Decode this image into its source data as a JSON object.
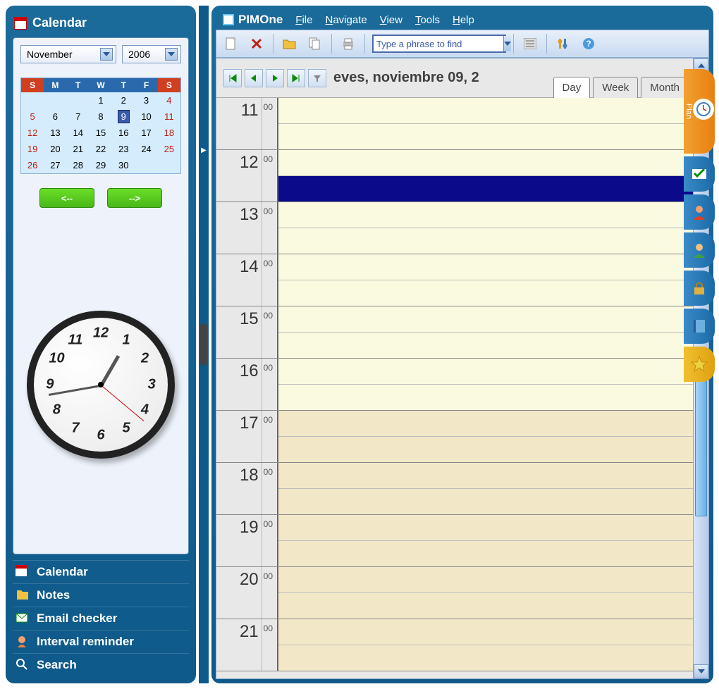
{
  "app": {
    "name": "PIMOne"
  },
  "menu": {
    "file": "File",
    "navigate": "Navigate",
    "view": "View",
    "tools": "Tools",
    "help": "Help"
  },
  "toolbar": {
    "search_placeholder": "Type a phrase to find"
  },
  "sidebar": {
    "title": "Calendar",
    "month": "November",
    "year": "2006",
    "prev": "<--",
    "next": "-->",
    "dayheaders": [
      "S",
      "M",
      "T",
      "W",
      "T",
      "F",
      "S"
    ],
    "weeks": [
      [
        "",
        "",
        "",
        "1",
        "2",
        "3",
        "4"
      ],
      [
        "5",
        "6",
        "7",
        "8",
        "9",
        "10",
        "11"
      ],
      [
        "12",
        "13",
        "14",
        "15",
        "16",
        "17",
        "18"
      ],
      [
        "19",
        "20",
        "21",
        "22",
        "23",
        "24",
        "25"
      ],
      [
        "26",
        "27",
        "28",
        "29",
        "30",
        "",
        ""
      ]
    ],
    "today": "9",
    "nav": [
      {
        "label": "Calendar",
        "icon": "calendar"
      },
      {
        "label": "Notes",
        "icon": "notes"
      },
      {
        "label": "Email checker",
        "icon": "email"
      },
      {
        "label": "Interval reminder",
        "icon": "reminder"
      },
      {
        "label": "Search",
        "icon": "search"
      }
    ]
  },
  "dayview": {
    "date_label": "eves, noviembre 09, 2",
    "tabs": {
      "day": "Day",
      "week": "Week",
      "month": "Month"
    },
    "hours": [
      11,
      12,
      13,
      14,
      15,
      16,
      17,
      18,
      19,
      20,
      21
    ],
    "minute_label": "00",
    "selected_slot": {
      "hour": 12,
      "half": 1
    },
    "afternoon_start": 17
  },
  "righttabs": {
    "plan": "Plan"
  },
  "clock": {
    "hour": 12,
    "minute": 47,
    "second": 20
  }
}
